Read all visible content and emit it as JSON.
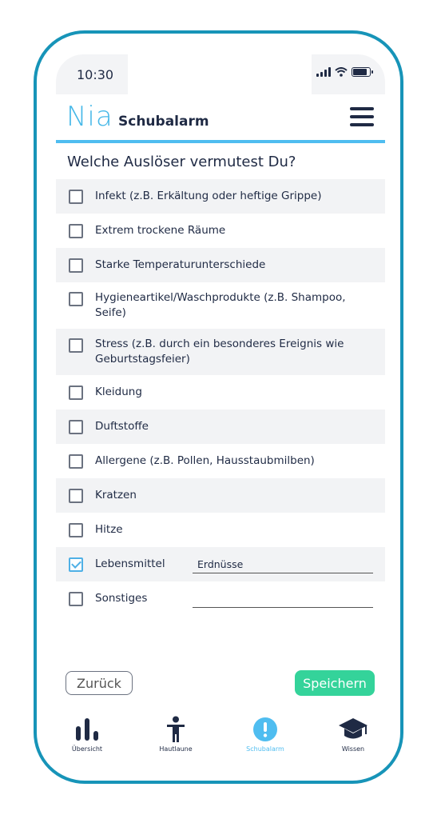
{
  "status_bar": {
    "time": "10:30"
  },
  "header": {
    "logo": "Nia",
    "title": "Schubalarm"
  },
  "question": "Welche Auslöser vermutest Du?",
  "options": [
    {
      "label": "Infekt (z.B. Erkältung oder heftige Grippe)",
      "checked": false
    },
    {
      "label": "Extrem trockene Räume",
      "checked": false
    },
    {
      "label": "Starke Temperaturunterschiede",
      "checked": false
    },
    {
      "label": "Hygieneartikel/Waschprodukte (z.B. Shampoo, Seife)",
      "checked": false
    },
    {
      "label": "Stress (z.B. durch ein besonderes Ereignis wie Geburtstagsfeier)",
      "checked": false
    },
    {
      "label": "Kleidung",
      "checked": false
    },
    {
      "label": "Duftstoffe",
      "checked": false
    },
    {
      "label": "Allergene (z.B. Pollen, Hausstaubmilben)",
      "checked": false
    },
    {
      "label": "Kratzen",
      "checked": false
    },
    {
      "label": "Hitze",
      "checked": false
    },
    {
      "label": "Lebensmittel",
      "checked": true,
      "field_value": "Erdnüsse"
    },
    {
      "label": "Sonstiges",
      "checked": false,
      "field_value": ""
    }
  ],
  "buttons": {
    "back": "Zurück",
    "save": "Speichern"
  },
  "tabs": [
    {
      "label": "Übersicht",
      "icon": "bar-chart-icon",
      "active": false
    },
    {
      "label": "Hautlaune",
      "icon": "person-icon",
      "active": false
    },
    {
      "label": "Schubalarm",
      "icon": "alert-icon",
      "active": true
    },
    {
      "label": "Wissen",
      "icon": "graduation-cap-icon",
      "active": false
    }
  ],
  "colors": {
    "frame": "#1794b8",
    "accent": "#4fbdf0",
    "save": "#34d39a",
    "text": "#1f2a44",
    "row_shade": "#f2f3f5"
  }
}
